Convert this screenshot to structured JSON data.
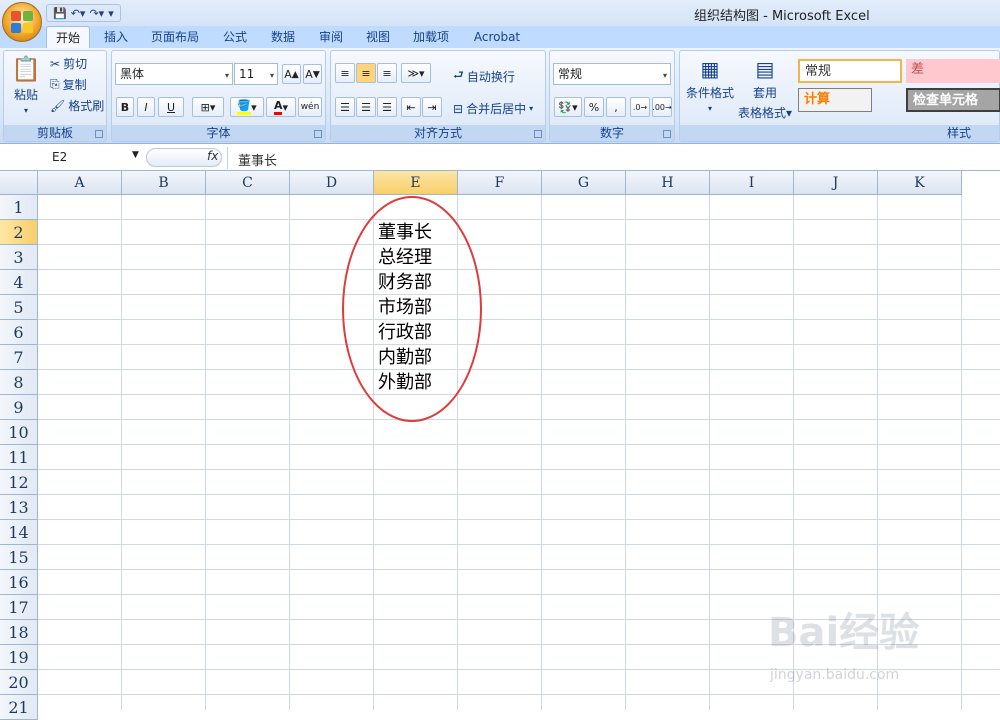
{
  "window": {
    "title": "组织结构图 - Microsoft Excel"
  },
  "tabs": [
    "开始",
    "插入",
    "页面布局",
    "公式",
    "数据",
    "审阅",
    "视图",
    "加载项",
    "Acrobat"
  ],
  "clipboard": {
    "paste": "粘贴",
    "cut": "剪切",
    "copy": "复制",
    "format_painter": "格式刷",
    "label": "剪贴板"
  },
  "font": {
    "name": "黑体",
    "size": "11",
    "label": "字体",
    "bold": "B",
    "italic": "I",
    "underline": "U",
    "font_color": "A",
    "phonetic": "wén"
  },
  "alignment": {
    "wrap": "自动换行",
    "merge": "合并后居中",
    "label": "对齐方式"
  },
  "number": {
    "format": "常规",
    "percent": "%",
    "comma": ",",
    "label": "数字"
  },
  "styles": {
    "conditional": "条件格式",
    "table1": "套用",
    "table2": "表格格式",
    "normal": "常规",
    "bad": "差",
    "calc": "计算",
    "check": "检查单元格",
    "label": "样式"
  },
  "formula_bar": {
    "cell_ref": "E2",
    "fx": "fx",
    "value": "董事长"
  },
  "columns": [
    "A",
    "B",
    "C",
    "D",
    "E",
    "F",
    "G",
    "H",
    "I",
    "J",
    "K"
  ],
  "rows": [
    "1",
    "2",
    "3",
    "4",
    "5",
    "6",
    "7",
    "8",
    "9",
    "10",
    "11",
    "12",
    "13",
    "14",
    "15",
    "16",
    "17",
    "18",
    "19",
    "20",
    "21"
  ],
  "cells": {
    "E2": "董事长",
    "E3": "总经理",
    "E4": "财务部",
    "E5": "市场部",
    "E6": "行政部",
    "E7": "内勤部",
    "E8": "外勤部"
  },
  "colors": {
    "oval": "#e03a3a",
    "selected_header": "#f8cf6a"
  },
  "watermark": {
    "brand": "Bai经验",
    "url": "jingyan.baidu.com"
  }
}
